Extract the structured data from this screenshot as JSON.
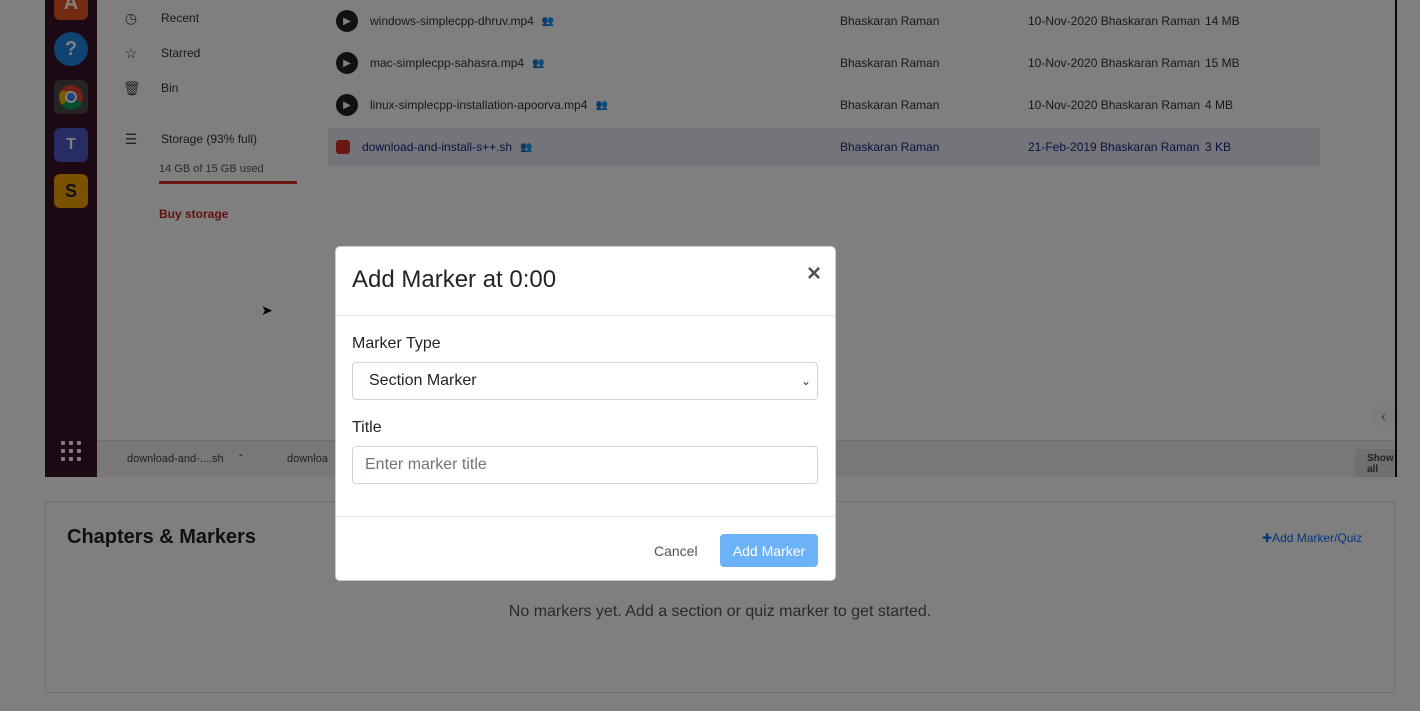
{
  "video": {
    "nav": {
      "recent": "Recent",
      "starred": "Starred",
      "bin": "Bin",
      "storage": "Storage (93% full)",
      "storage_used": "14 GB of 15 GB used",
      "storage_fraction": 0.93,
      "buy_storage": "Buy storage"
    },
    "files": [
      {
        "name": "windows-simplecpp-dhruv.mp4",
        "owner": "Bhaskaran Raman",
        "modified": "10-Nov-2020 Bhaskaran Raman",
        "size": "14 MB"
      },
      {
        "name": "mac-simplecpp-sahasra.mp4",
        "owner": "Bhaskaran Raman",
        "modified": "10-Nov-2020 Bhaskaran Raman",
        "size": "15 MB"
      },
      {
        "name": "linux-simplecpp-installation-apoorva.mp4",
        "owner": "Bhaskaran Raman",
        "modified": "10-Nov-2020 Bhaskaran Raman",
        "size": "4 MB"
      },
      {
        "name": "download-and-install-s++.sh",
        "owner": "Bhaskaran Raman",
        "modified": "21-Feb-2019 Bhaskaran Raman",
        "size": "3 KB"
      }
    ],
    "downloads": {
      "item1": "download-and-....sh",
      "item2": "downloa",
      "show_all": "Show all"
    }
  },
  "chapters": {
    "title": "Chapters & Markers",
    "add_link": "Add Marker/Quiz",
    "empty_message": "No markers yet. Add a section or quiz marker to get started."
  },
  "modal": {
    "title": "Add Marker at 0:00",
    "close_symbol": "×",
    "marker_type_label": "Marker Type",
    "marker_type_value": "Section Marker",
    "title_label": "Title",
    "title_placeholder": "Enter marker title",
    "cancel_label": "Cancel",
    "add_label": "Add Marker"
  },
  "colors": {
    "primary_button": "#6cb2f8",
    "link": "#0d6efd",
    "dock": "#3a1229",
    "storage_warning": "#d93025"
  }
}
